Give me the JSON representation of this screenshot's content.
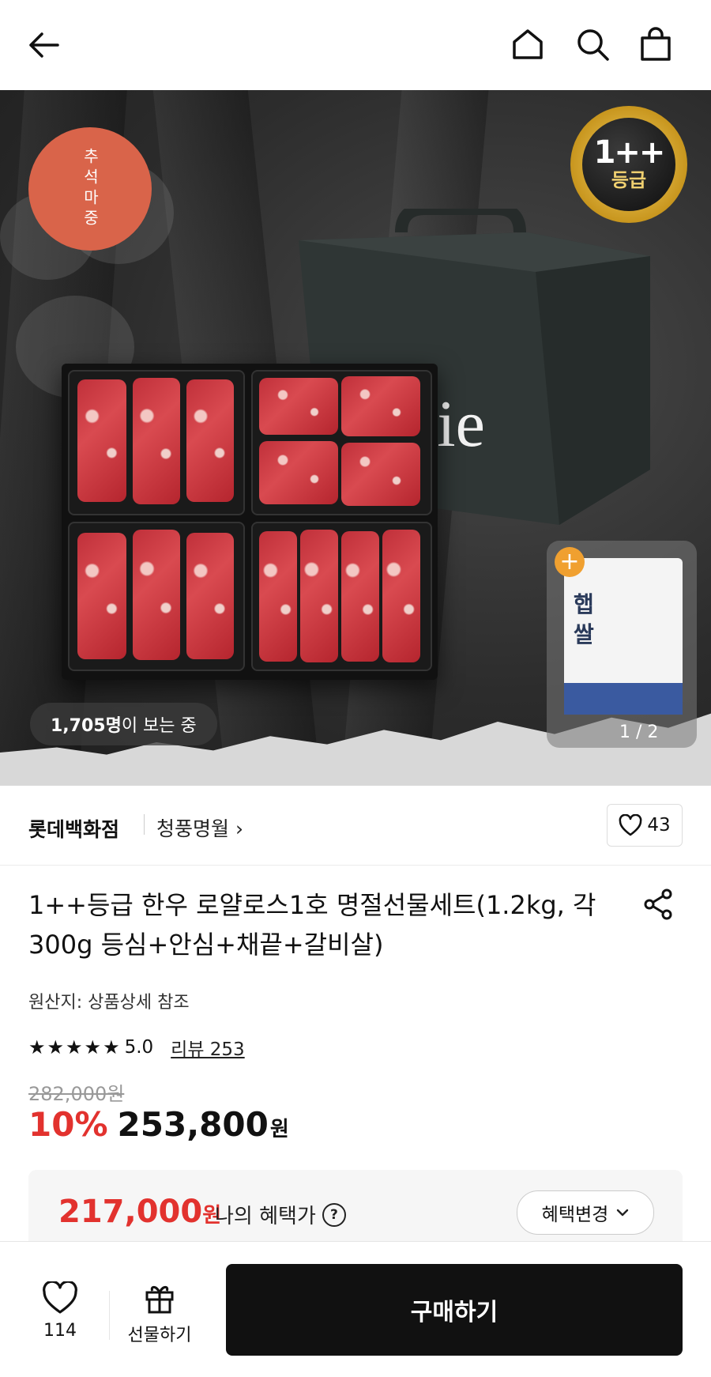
{
  "header": {
    "back_icon": "arrow-left-icon",
    "home_icon": "home-icon",
    "search_icon": "search-icon",
    "cart_icon": "shopping-bag-icon"
  },
  "hero": {
    "promo_badge": "추석마중",
    "grade_badge_top": "1++",
    "grade_badge_bottom": "등급",
    "bag_text": "erie",
    "viewers_count": "1,705명",
    "viewers_suffix": "이 보는 중",
    "addon_title": "햅\n쌀",
    "addon_plus": "+",
    "pager": "1 / 2"
  },
  "seller": {
    "store": "롯데백화점",
    "brand": "청풍명월 ›",
    "like_count": "43"
  },
  "product": {
    "title": "1++등급 한우 로얄로스1호 명절선물세트(1.2kg, 각300g 등심+안심+채끝+갈비살)",
    "origin": "원산지: 상품상세 참조",
    "stars": "★★★★★",
    "rating": "5.0",
    "review_label": "리뷰 253",
    "original_price": "282,000원",
    "discount": "10%",
    "price": "253,800",
    "price_unit": "원"
  },
  "benefit": {
    "price": "217,000",
    "price_unit": "원",
    "label": "나의 혜택가",
    "help": "?",
    "change_button": "혜택변경"
  },
  "bottom_bar": {
    "wishlist_count": "114",
    "gift_label": "선물하기",
    "buy_label": "구매하기"
  }
}
